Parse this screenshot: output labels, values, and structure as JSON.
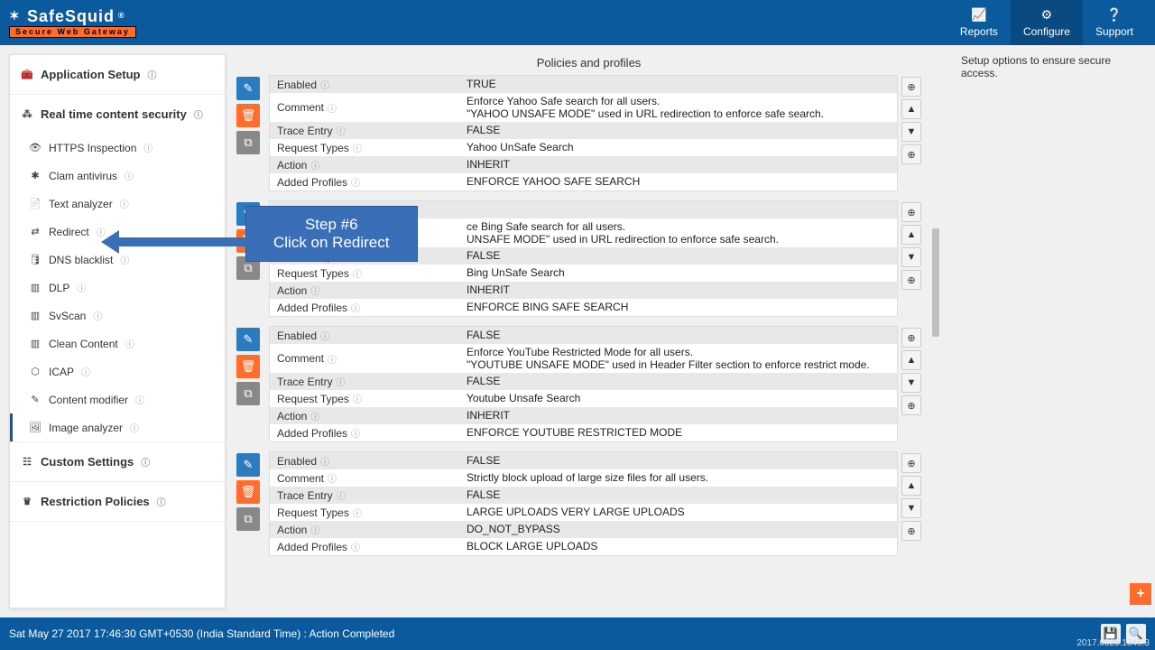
{
  "brand": {
    "name": "SafeSquid",
    "reg": "®",
    "tagline": "Secure Web Gateway"
  },
  "nav": {
    "reports": "Reports",
    "configure": "Configure",
    "support": "Support"
  },
  "sidebar": {
    "app_setup": "Application Setup",
    "rtcs": "Real time content security",
    "items": [
      {
        "icon": "👁",
        "label": "HTTPS Inspection"
      },
      {
        "icon": "✱",
        "label": "Clam antivirus"
      },
      {
        "icon": "📄",
        "label": "Text analyzer"
      },
      {
        "icon": "⇄",
        "label": "Redirect"
      },
      {
        "icon": "🛢",
        "label": "DNS blacklist"
      },
      {
        "icon": "▥",
        "label": "DLP"
      },
      {
        "icon": "▥",
        "label": "SvScan"
      },
      {
        "icon": "▥",
        "label": "Clean Content"
      },
      {
        "icon": "⬡",
        "label": "ICAP"
      },
      {
        "icon": "✎",
        "label": "Content modifier"
      },
      {
        "icon": "🖼",
        "label": "Image analyzer"
      }
    ],
    "custom": "Custom Settings",
    "restriction": "Restriction Policies"
  },
  "main": {
    "title": "Policies and profiles",
    "fields": {
      "enabled": "Enabled",
      "comment": "Comment",
      "trace": "Trace Entry",
      "reqtypes": "Request Types",
      "action": "Action",
      "added": "Added Profiles"
    },
    "cards": [
      {
        "enabled": "TRUE",
        "comment": "Enforce Yahoo Safe search for all users.\n\"YAHOO UNSAFE MODE\" used in URL redirection to enforce safe search.",
        "trace": "FALSE",
        "reqtypes": "Yahoo UnSafe Search",
        "action": "INHERIT",
        "added": "ENFORCE YAHOO SAFE SEARCH"
      },
      {
        "enabled": "",
        "comment": "ce Bing Safe search for all users.\nUNSAFE MODE\" used in URL redirection to enforce safe search.",
        "trace": "FALSE",
        "reqtypes": "Bing UnSafe Search",
        "action": "INHERIT",
        "added": "ENFORCE BING SAFE SEARCH"
      },
      {
        "enabled": "FALSE",
        "comment": "Enforce YouTube Restricted Mode for all users.\n\"YOUTUBE UNSAFE MODE\" used in Header Filter section to enforce restrict mode.",
        "trace": "FALSE",
        "reqtypes": "Youtube Unsafe Search",
        "action": "INHERIT",
        "added": "ENFORCE YOUTUBE RESTRICTED MODE"
      },
      {
        "enabled": "FALSE",
        "comment": "Strictly block upload of large size files for all users.",
        "trace": "FALSE",
        "reqtypes": "LARGE UPLOADS   VERY LARGE UPLOADS",
        "action": "DO_NOT_BYPASS",
        "added": "BLOCK LARGE UPLOADS"
      }
    ]
  },
  "right": {
    "desc": "Setup options to ensure secure access."
  },
  "callout": {
    "line1": "Step #6",
    "line2": "Click on Redirect"
  },
  "footer": {
    "status": "Sat May 27 2017 17:46:30 GMT+0530 (India Standard Time) : Action Completed",
    "version": "2017.0525.1345.3"
  }
}
